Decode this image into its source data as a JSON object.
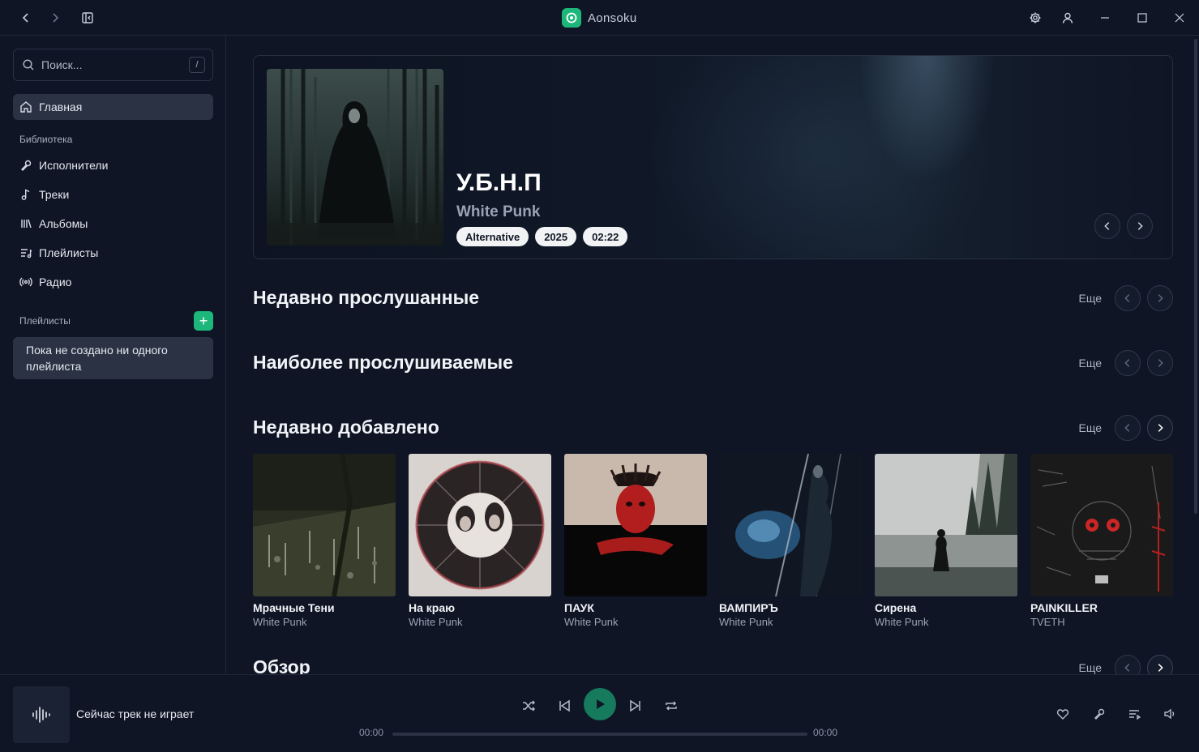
{
  "app": {
    "name": "Aonsoku"
  },
  "sidebar": {
    "search_placeholder": "Поиск...",
    "search_shortcut": "/",
    "home_label": "Главная",
    "library_label": "Библиотека",
    "items": [
      {
        "label": "Исполнители",
        "icon": "mic-icon"
      },
      {
        "label": "Треки",
        "icon": "music-note-icon"
      },
      {
        "label": "Альбомы",
        "icon": "library-icon"
      },
      {
        "label": "Плейлисты",
        "icon": "list-music-icon"
      },
      {
        "label": "Радио",
        "icon": "radio-icon"
      }
    ],
    "playlists_label": "Плейлисты",
    "add_symbol": "+",
    "empty_playlists": "Пока не создано ни одного плейлиста"
  },
  "hero": {
    "title": "У.Б.Н.П",
    "artist": "White Punk",
    "tags": [
      "Alternative",
      "2025",
      "02:22"
    ]
  },
  "sections": {
    "recent_played": "Недавно прослушанные",
    "most_played": "Наиболее прослушиваемые",
    "recently_added": "Недавно добавлено",
    "explore": "Обзор",
    "more_label": "Еще"
  },
  "albums": [
    {
      "title": "Мрачные Тени",
      "artist": "White Punk"
    },
    {
      "title": "На краю",
      "artist": "White Punk"
    },
    {
      "title": "ПАУК",
      "artist": "White Punk"
    },
    {
      "title": "ВАМПИРЪ",
      "artist": "White Punk"
    },
    {
      "title": "Сирена",
      "artist": "White Punk"
    },
    {
      "title": "PAINKILLER",
      "artist": "TVETH"
    }
  ],
  "player": {
    "now_playing": "Сейчас трек не играет",
    "time_current": "00:00",
    "time_total": "00:00",
    "progress": 0
  },
  "colors": {
    "accent": "#1db77b",
    "background": "#0f1525",
    "active_item": "#2a3244"
  }
}
